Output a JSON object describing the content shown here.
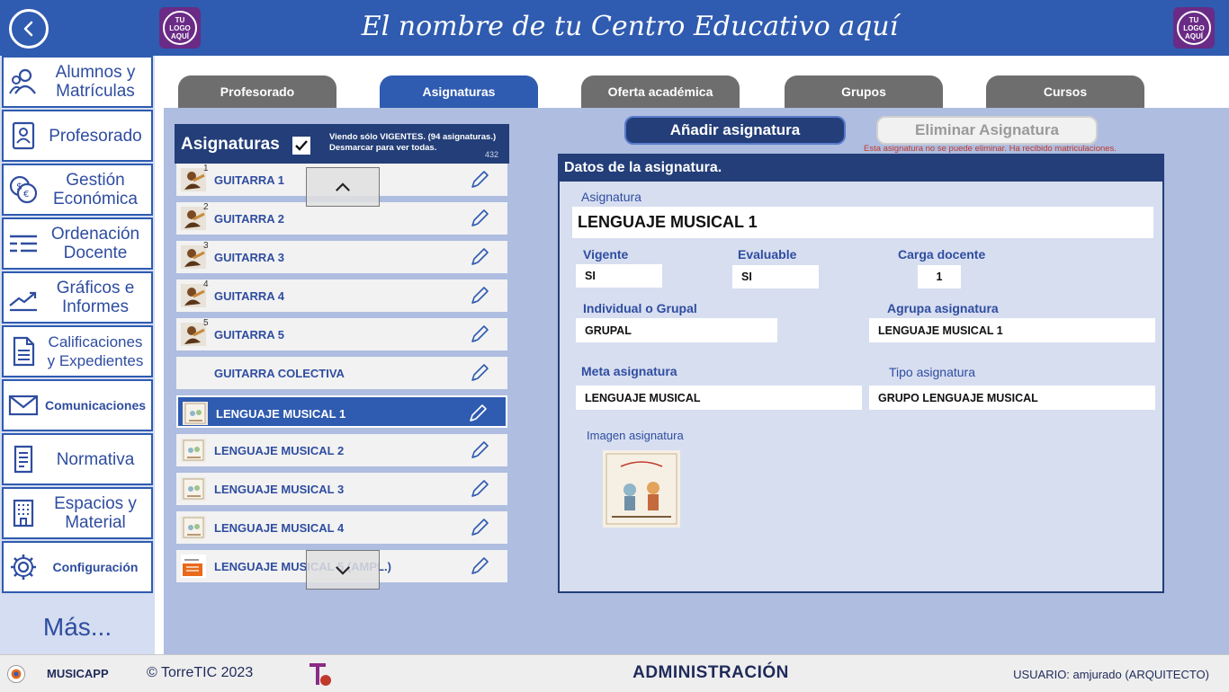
{
  "header": {
    "school_name": "El nombre de tu Centro Educativo aquí",
    "logo_left": [
      "TU",
      "LOGO",
      "AQUÍ"
    ],
    "logo_right": [
      "TU",
      "LOGO",
      "AQUÍ"
    ]
  },
  "sidebar": {
    "items": [
      {
        "label": "Alumnos y Matrículas",
        "icon": "users-icon"
      },
      {
        "label": "Profesorado",
        "icon": "teacher-badge-icon"
      },
      {
        "label": "Gestión Económica",
        "icon": "money-exchange-icon"
      },
      {
        "label": "Ordenación Docente",
        "icon": "list-icon"
      },
      {
        "label": "Gráficos e Informes",
        "icon": "trend-chart-icon"
      },
      {
        "label": "Calificaciones y Expedientes",
        "icon": "document-icon"
      },
      {
        "label": "Comunicaciones",
        "icon": "mail-icon"
      },
      {
        "label": "Normativa",
        "icon": "regulation-icon"
      },
      {
        "label": "Espacios y Material",
        "icon": "building-icon"
      },
      {
        "label": "Configuración",
        "icon": "gear-icon"
      }
    ],
    "more": "Más..."
  },
  "tabs": [
    {
      "label": "Profesorado",
      "active": false
    },
    {
      "label": "Asignaturas",
      "active": true
    },
    {
      "label": "Oferta académica",
      "active": false
    },
    {
      "label": "Grupos",
      "active": false
    },
    {
      "label": "Cursos",
      "active": false
    }
  ],
  "list": {
    "title": "Asignaturas",
    "checkbox_checked": true,
    "note_line1": "Viendo sólo VIGENTES. (94 asignaturas.)",
    "note_line2": "Desmarcar para ver todas.",
    "count": "432",
    "items": [
      {
        "name": "GUITARRA 1",
        "sup": "1",
        "thumb": "guitar",
        "selected": false
      },
      {
        "name": "GUITARRA 2",
        "sup": "2",
        "thumb": "guitar",
        "selected": false
      },
      {
        "name": "GUITARRA 3",
        "sup": "3",
        "thumb": "guitar",
        "selected": false
      },
      {
        "name": "GUITARRA 4",
        "sup": "4",
        "thumb": "guitar",
        "selected": false
      },
      {
        "name": "GUITARRA 5",
        "sup": "5",
        "thumb": "guitar",
        "selected": false
      },
      {
        "name": "GUITARRA COLECTIVA",
        "sup": "",
        "thumb": "",
        "selected": false
      },
      {
        "name": "LENGUAJE MUSICAL 1",
        "sup": "",
        "thumb": "book",
        "selected": true
      },
      {
        "name": "LENGUAJE MUSICAL 2",
        "sup": "",
        "thumb": "book",
        "selected": false
      },
      {
        "name": "LENGUAJE MUSICAL 3",
        "sup": "",
        "thumb": "book",
        "selected": false
      },
      {
        "name": "LENGUAJE MUSICAL 4",
        "sup": "",
        "thumb": "book",
        "selected": false
      },
      {
        "name": "LENGUAJE MUSICAL 5 (AMPL.)",
        "sup": "",
        "thumb": "orange",
        "selected": false
      }
    ]
  },
  "actions": {
    "add_label": "Añadir asignatura",
    "delete_label": "Eliminar Asignatura",
    "delete_warning": "Esta asignatura no se puede eliminar. Ha recibido matriculaciones."
  },
  "detail": {
    "title": "Datos de la asignatura.",
    "asignatura_label": "Asignatura",
    "asignatura_value": "LENGUAJE MUSICAL 1",
    "vigente_label": "Vigente",
    "vigente_value": "SI",
    "evaluable_label": "Evaluable",
    "evaluable_value": "SI",
    "carga_label": "Carga docente",
    "carga_value": "1",
    "individual_label": "Individual o Grupal",
    "individual_value": "GRUPAL",
    "agrupa_label": "Agrupa asignatura",
    "agrupa_value": "LENGUAJE MUSICAL 1",
    "meta_label": "Meta asignatura",
    "meta_value": "LENGUAJE MUSICAL",
    "tipo_label": "Tipo asignatura",
    "tipo_value": "GRUPO LENGUAJE MUSICAL",
    "imagen_label": "Imagen asignatura"
  },
  "footer": {
    "app_name": "MUSICAPP",
    "copyright": "© TorreTIC  2023",
    "section": "ADMINISTRACIÓN",
    "user": "USUARIO: amjurado (ARQUITECTO)"
  },
  "colors": {
    "primary": "#2f5bb0",
    "dark": "#233e78",
    "tab_inactive": "#6e6e6e",
    "main_bg": "#aebde0",
    "warning": "#c0392b"
  }
}
